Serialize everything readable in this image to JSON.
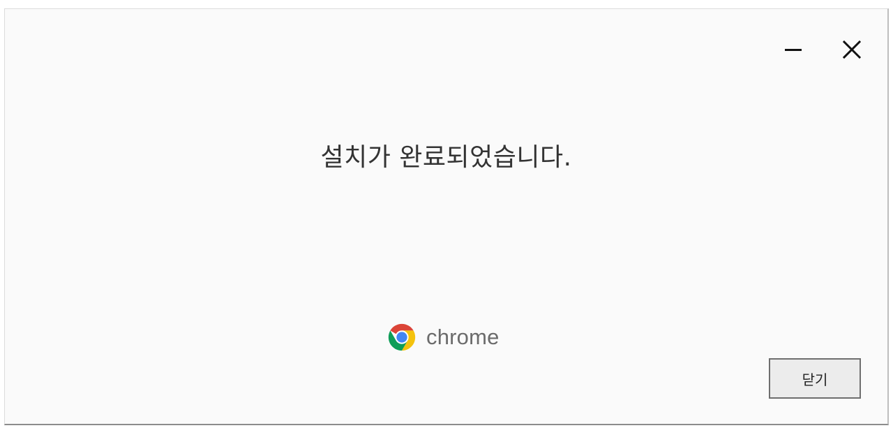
{
  "window": {
    "minimize_label": "minimize",
    "close_label": "close"
  },
  "main": {
    "message": "설치가 완료되었습니다."
  },
  "brand": {
    "logo_icon": "chrome-logo-icon",
    "name": "chrome"
  },
  "footer": {
    "close_button_label": "닫기"
  },
  "colors": {
    "background": "#fafafa",
    "text": "#333333",
    "brand_text": "#6b6b6b",
    "chrome_red": "#db4437",
    "chrome_yellow": "#f4c20d",
    "chrome_green": "#0f9d58",
    "chrome_blue": "#4285f4"
  }
}
